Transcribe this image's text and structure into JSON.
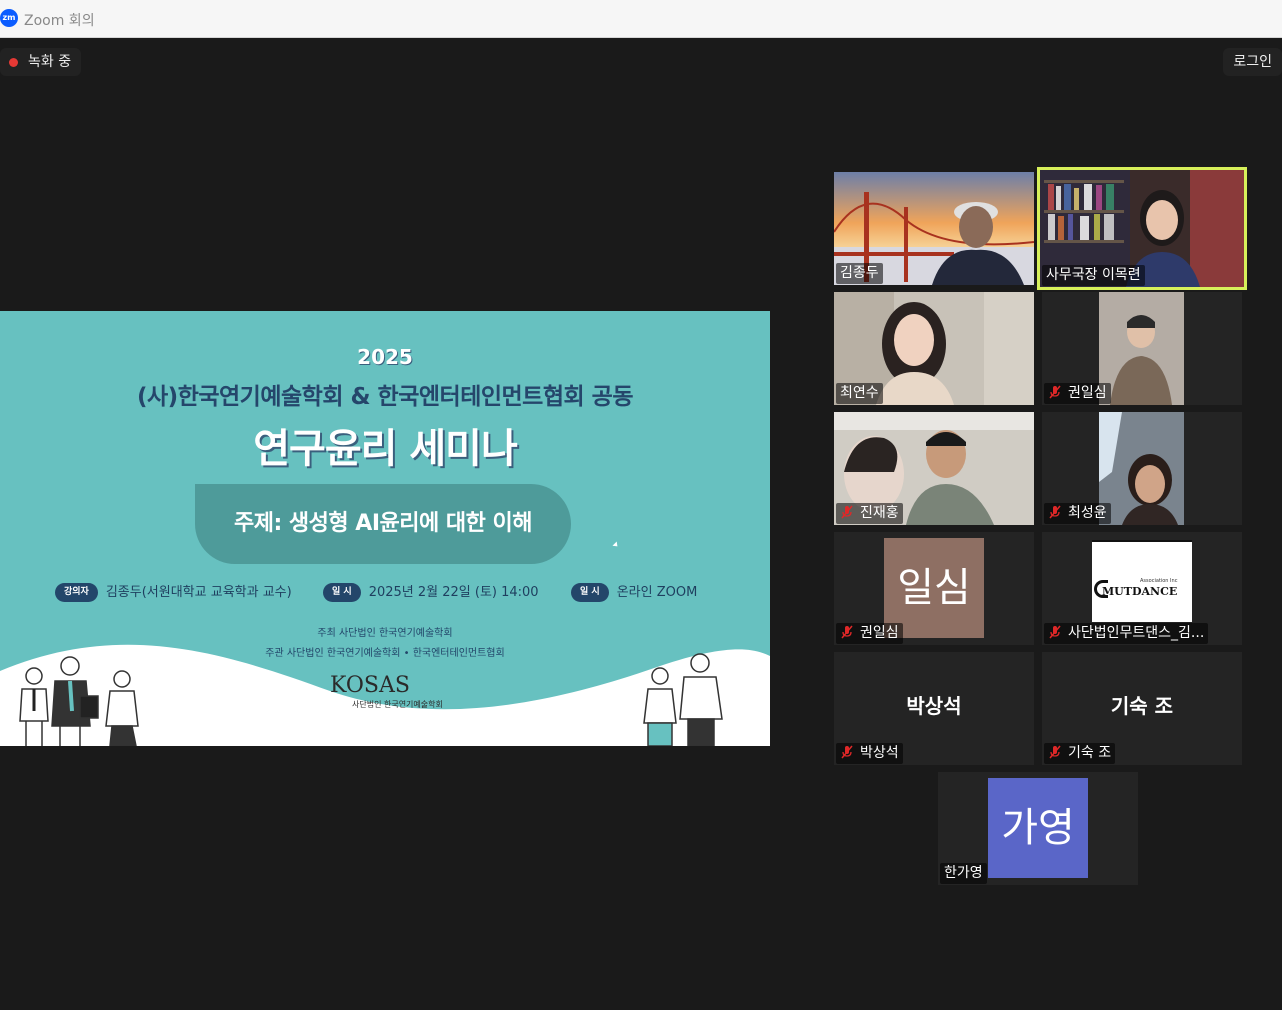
{
  "window": {
    "title": "Zoom 회의",
    "logo_text": "zm"
  },
  "recording": {
    "label": "녹화 중"
  },
  "login": {
    "label": "로그인"
  },
  "slide": {
    "year": "2025",
    "subtitle": "(사)한국연기예술학회 & 한국엔터테인먼트협회 공동",
    "main_title": "연구윤리 세미나",
    "topic": "주제: 생성형 AI윤리에 대한 이해",
    "speaker_tag": "강의자",
    "speaker": "김종두(서원대학교 교육학과 교수)",
    "date_tag": "일 시",
    "date": "2025년 2월 22일 (토) 14:00",
    "place_tag": "일 시",
    "place": "온라인 ZOOM",
    "host_line": "주최   사단법인 한국연기예술학회",
    "organizer_line": "주관   사단법인 한국연기예술학회 • 한국엔터테인먼트협회",
    "logo": "KOSAS",
    "logo_sub": "사단법인 한국연기예술학회"
  },
  "participants": [
    {
      "name": "김종두",
      "muted": false,
      "type": "video"
    },
    {
      "name": "사무국장 이목련",
      "muted": false,
      "type": "video",
      "active": true
    },
    {
      "name": "최연수",
      "muted": false,
      "type": "video"
    },
    {
      "name": "권일심",
      "muted": true,
      "type": "video"
    },
    {
      "name": "진재홍",
      "muted": true,
      "type": "video"
    },
    {
      "name": "최성윤",
      "muted": true,
      "type": "video"
    },
    {
      "name": "권일심",
      "muted": true,
      "type": "avatar",
      "avatar_text": "일심",
      "avatar_color": "#8e6f63"
    },
    {
      "name": "사단법인무트댄스_김...",
      "muted": true,
      "type": "logo",
      "logo_text": "MUTDANCE",
      "logo_sub": "Association Inc"
    },
    {
      "name": "박상석",
      "muted": true,
      "type": "text",
      "big_text": "박상석"
    },
    {
      "name": "기숙 조",
      "muted": true,
      "type": "text",
      "big_text": "기숙 조"
    },
    {
      "name": "한가영",
      "muted": false,
      "type": "avatar",
      "avatar_text": "가영",
      "avatar_color": "#5a66c8"
    }
  ],
  "colors": {
    "accent_active": "#d7f05a",
    "slide_bg": "#67c1c0",
    "record_dot": "#e53935"
  }
}
